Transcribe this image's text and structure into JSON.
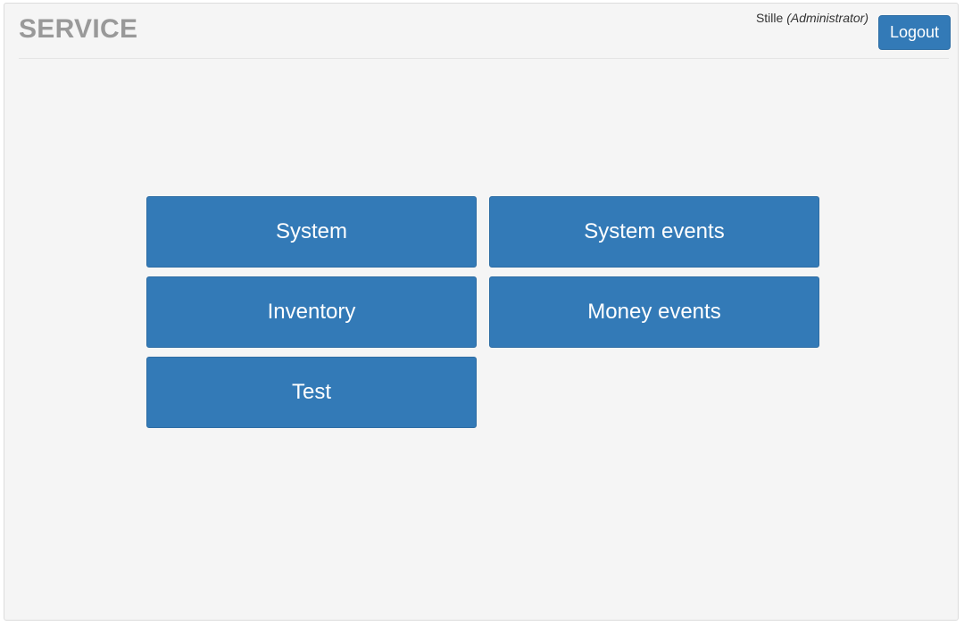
{
  "header": {
    "title": "SERVICE",
    "user_name": "Stille",
    "user_role": "(Administrator)",
    "logout_label": "Logout"
  },
  "menu": {
    "tiles": [
      {
        "label": "System"
      },
      {
        "label": "System events"
      },
      {
        "label": "Inventory"
      },
      {
        "label": "Money events"
      },
      {
        "label": "Test"
      }
    ]
  },
  "colors": {
    "primary": "#337ab7",
    "primary_border": "#2e6da4",
    "page_background": "#f5f5f5",
    "title": "#999999"
  }
}
